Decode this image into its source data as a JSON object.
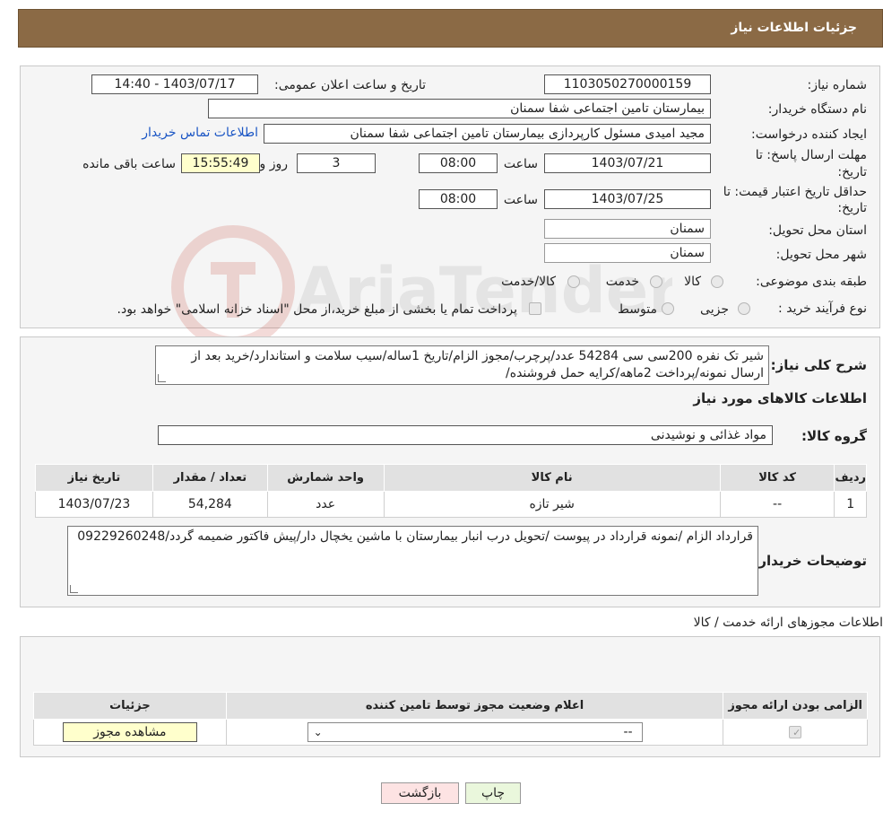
{
  "header": {
    "title": "جزئیات اطلاعات نیاز"
  },
  "watermark": {
    "text": "AriaTender.neT"
  },
  "fields": {
    "need_number_label": "شماره نیاز:",
    "need_number": "1103050270000159",
    "announce_label": "تاریخ و ساعت اعلان عمومی:",
    "announce_value": "1403/07/17 - 14:40",
    "buyer_org_label": "نام دستگاه خریدار:",
    "buyer_org": "بیمارستان تامین اجتماعی شفا سمنان",
    "creator_label": "ایجاد کننده درخواست:",
    "creator": "مجید امیدی مسئول کارپردازی بیمارستان تامین اجتماعی شفا سمنان",
    "contact_link": "اطلاعات تماس خریدار",
    "deadline_label_1": "مهلت ارسال پاسخ: تا",
    "deadline_label_2": "تاریخ:",
    "deadline_date": "1403/07/21",
    "time_label": "ساعت",
    "deadline_time": "08:00",
    "days_value": "3",
    "days_label": "روز و",
    "remaining_time": "15:55:49",
    "remaining_label": "ساعت باقی مانده",
    "validity_label_1": "حداقل تاریخ اعتبار قیمت: تا",
    "validity_label_2": "تاریخ:",
    "validity_date": "1403/07/25",
    "validity_time": "08:00",
    "province_label": "استان محل تحویل:",
    "province": "سمنان",
    "city_label": "شهر محل تحویل:",
    "city": "سمنان",
    "category_label": "طبقه بندی موضوعی:",
    "category_options": [
      "کالا",
      "خدمت",
      "کالا/خدمت"
    ],
    "process_label": "نوع فرآیند خرید :",
    "process_options": [
      "جزیی",
      "متوسط"
    ],
    "process_note": "پرداخت تمام یا بخشی از مبلغ خرید،از محل \"اسناد خزانه اسلامی\" خواهد بود."
  },
  "description": {
    "label": "شرح کلی نیاز:",
    "text": "شیر تک نفره 200سی سی 54284 عدد/پرچرب/مجوز الزام/تاریخ 1ساله/سیب سلامت و استاندارد/خرید بعد از ارسال نمونه/پرداخت 2ماهه/کرایه حمل فروشنده/"
  },
  "goods": {
    "section_title": "اطلاعات کالاهای مورد نیاز",
    "group_label": "گروه کالا:",
    "group_value": "مواد غذائی و نوشیدنی",
    "columns": [
      "ردیف",
      "کد کالا",
      "نام کالا",
      "واحد شمارش",
      "تعداد / مقدار",
      "تاریخ نیاز"
    ],
    "rows": [
      [
        "1",
        "--",
        "شیر تازه",
        "عدد",
        "54,284",
        "1403/07/23"
      ]
    ]
  },
  "buyer_notes": {
    "label": "توضیحات خریدار:",
    "text": "قرارداد الزام /نمونه قرارداد در پیوست /تحویل درب انبار بیمارستان با ماشین یخچال دار/پیش فاکتور ضمیمه گردد/09229260248"
  },
  "permits": {
    "section_title": "اطلاعات مجوزهای ارائه خدمت / کالا",
    "columns": [
      "الزامی بودن ارائه مجوز",
      "اعلام وضعیت مجوز توسط تامین کننده",
      "جزئیات"
    ],
    "select_value": "--",
    "view_button": "مشاهده مجوز"
  },
  "actions": {
    "print": "چاپ",
    "back": "بازگشت"
  },
  "colors": {
    "header_bg": "#8b6a45",
    "back_bg": "#fde3e3",
    "print_bg": "#eaf7dc",
    "link": "#1a55c4"
  }
}
